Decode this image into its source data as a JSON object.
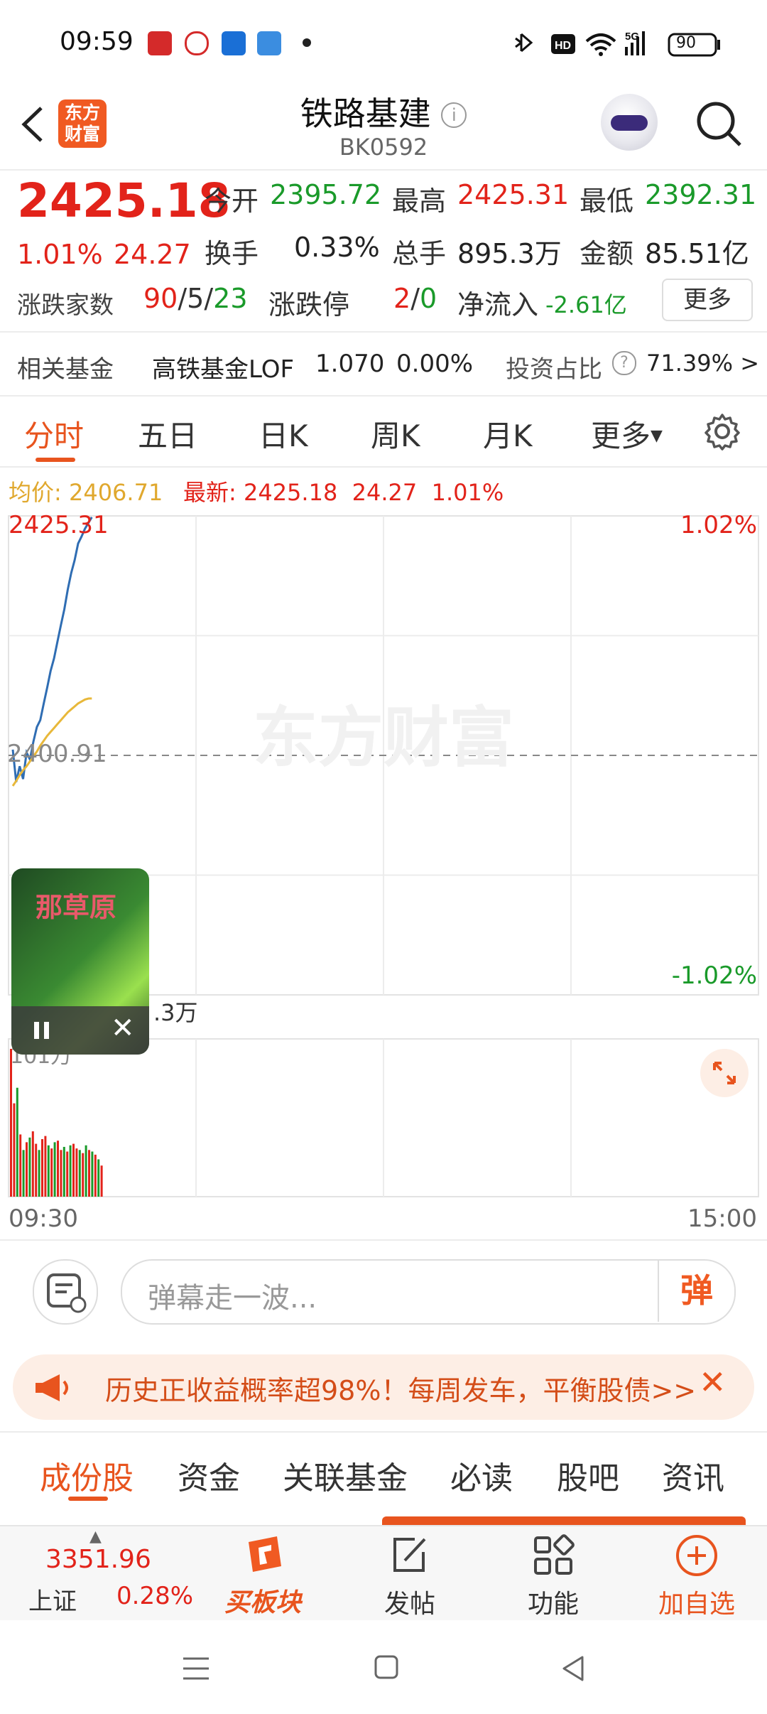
{
  "status_bar": {
    "time": "09:59",
    "network": "5G",
    "battery": "90"
  },
  "header": {
    "back_icon": "back-arrow-icon",
    "logo_text": "东方财富",
    "title": "铁路基建",
    "code": "BK0592"
  },
  "quote": {
    "price": "2425.18",
    "change_pct": "1.01%",
    "change_amt": "24.27",
    "open_label": "今开",
    "open": "2395.72",
    "high_label": "最高",
    "high": "2425.31",
    "low_label": "最低",
    "low": "2392.31",
    "turnover_label": "换手",
    "turnover": "0.33%",
    "volume_label": "总手",
    "volume": "895.3万",
    "amount_label": "金额",
    "amount": "85.51亿",
    "breadth_label": "涨跌家数",
    "up": "90",
    "flat": "5",
    "down": "23",
    "limit_label": "涨跌停",
    "limit_up": "2",
    "limit_down": "0",
    "netflow_label": "净流入",
    "netflow": "-2.61亿",
    "more_button": "更多"
  },
  "fund": {
    "label": "相关基金",
    "name": "高铁基金LOF",
    "price": "1.070",
    "change": "0.00%",
    "ratio_label": "投资占比",
    "ratio": "71.39% >"
  },
  "chart_tabs": [
    "分时",
    "五日",
    "日K",
    "周K",
    "月K",
    "更多"
  ],
  "chart_info": {
    "avg_label": "均价:",
    "avg": "2406.71",
    "latest_label": "最新:",
    "latest": "2425.18",
    "change": "24.27",
    "pct": "1.01%"
  },
  "chart_data": {
    "type": "line",
    "title": "",
    "x_start": "09:30",
    "x_end": "15:00",
    "y_top_label": "2425.31",
    "y_mid_label": "2400.91",
    "pct_top": "1.02%",
    "pct_bottom": "-1.02%",
    "ylim": [
      2376.51,
      2425.31
    ],
    "reference": 2400.91,
    "total_minutes": 240,
    "series": [
      {
        "name": "",
        "color": "#2f6db3",
        "values": [
          2401.5,
          2398.2,
          2399.8,
          2398.5,
          2401.2,
          2400.5,
          2402.3,
          2403.8,
          2404.5,
          2406.2,
          2407.8,
          2409.5,
          2410.8,
          2412.5,
          2414.2,
          2415.8,
          2417.8,
          2419.5,
          2420.8,
          2422.5,
          2423.2,
          2424.0,
          2424.6,
          2425.18
        ]
      },
      {
        "name": "",
        "color": "#e8b83a",
        "values": [
          2397.8,
          2398.3,
          2398.9,
          2399.4,
          2399.8,
          2400.3,
          2400.8,
          2401.3,
          2401.9,
          2402.4,
          2402.9,
          2403.3,
          2403.7,
          2404.1,
          2404.5,
          2404.9,
          2405.3,
          2405.6,
          2405.9,
          2406.2,
          2406.4,
          2406.6,
          2406.7,
          2406.71
        ]
      }
    ],
    "volume_label": ".3万",
    "volume_sub_label": "101万",
    "volume": [
      95,
      60,
      70,
      40,
      30,
      35,
      38,
      42,
      34,
      30,
      37,
      39,
      33,
      31,
      35,
      36,
      30,
      32,
      29,
      33,
      34,
      31,
      30,
      28,
      33,
      30,
      29,
      27,
      24,
      20
    ],
    "volume_colors": [
      "r",
      "r",
      "g",
      "r",
      "g",
      "r",
      "g",
      "r",
      "r",
      "g",
      "r",
      "r",
      "g",
      "r",
      "g",
      "r",
      "r",
      "g",
      "r",
      "g",
      "r",
      "r",
      "g",
      "r",
      "g",
      "r",
      "g",
      "r",
      "g",
      "r"
    ]
  },
  "watermark": "东方财富",
  "video_popup": {
    "text": "那草原"
  },
  "danmu": {
    "placeholder": "弹幕走一波...",
    "send": "弹"
  },
  "banner": {
    "text": "历史正收益概率超98%！每周发车，平衡股债>>"
  },
  "bottom_tabs": [
    "成份股",
    "资金",
    "关联基金",
    "必读",
    "股吧",
    "资讯"
  ],
  "bottom_nav": {
    "index_value": "3351.96",
    "index_name": "上证",
    "index_pct": "0.28%",
    "buy_label": "买板块",
    "post_label": "发帖",
    "func_label": "功能",
    "add_label": "加自选"
  },
  "colors": {
    "up": "#e2231a",
    "down": "#1a9a2a",
    "accent": "#e8541e",
    "price_line": "#2f6db3",
    "avg_line": "#e8b83a"
  }
}
